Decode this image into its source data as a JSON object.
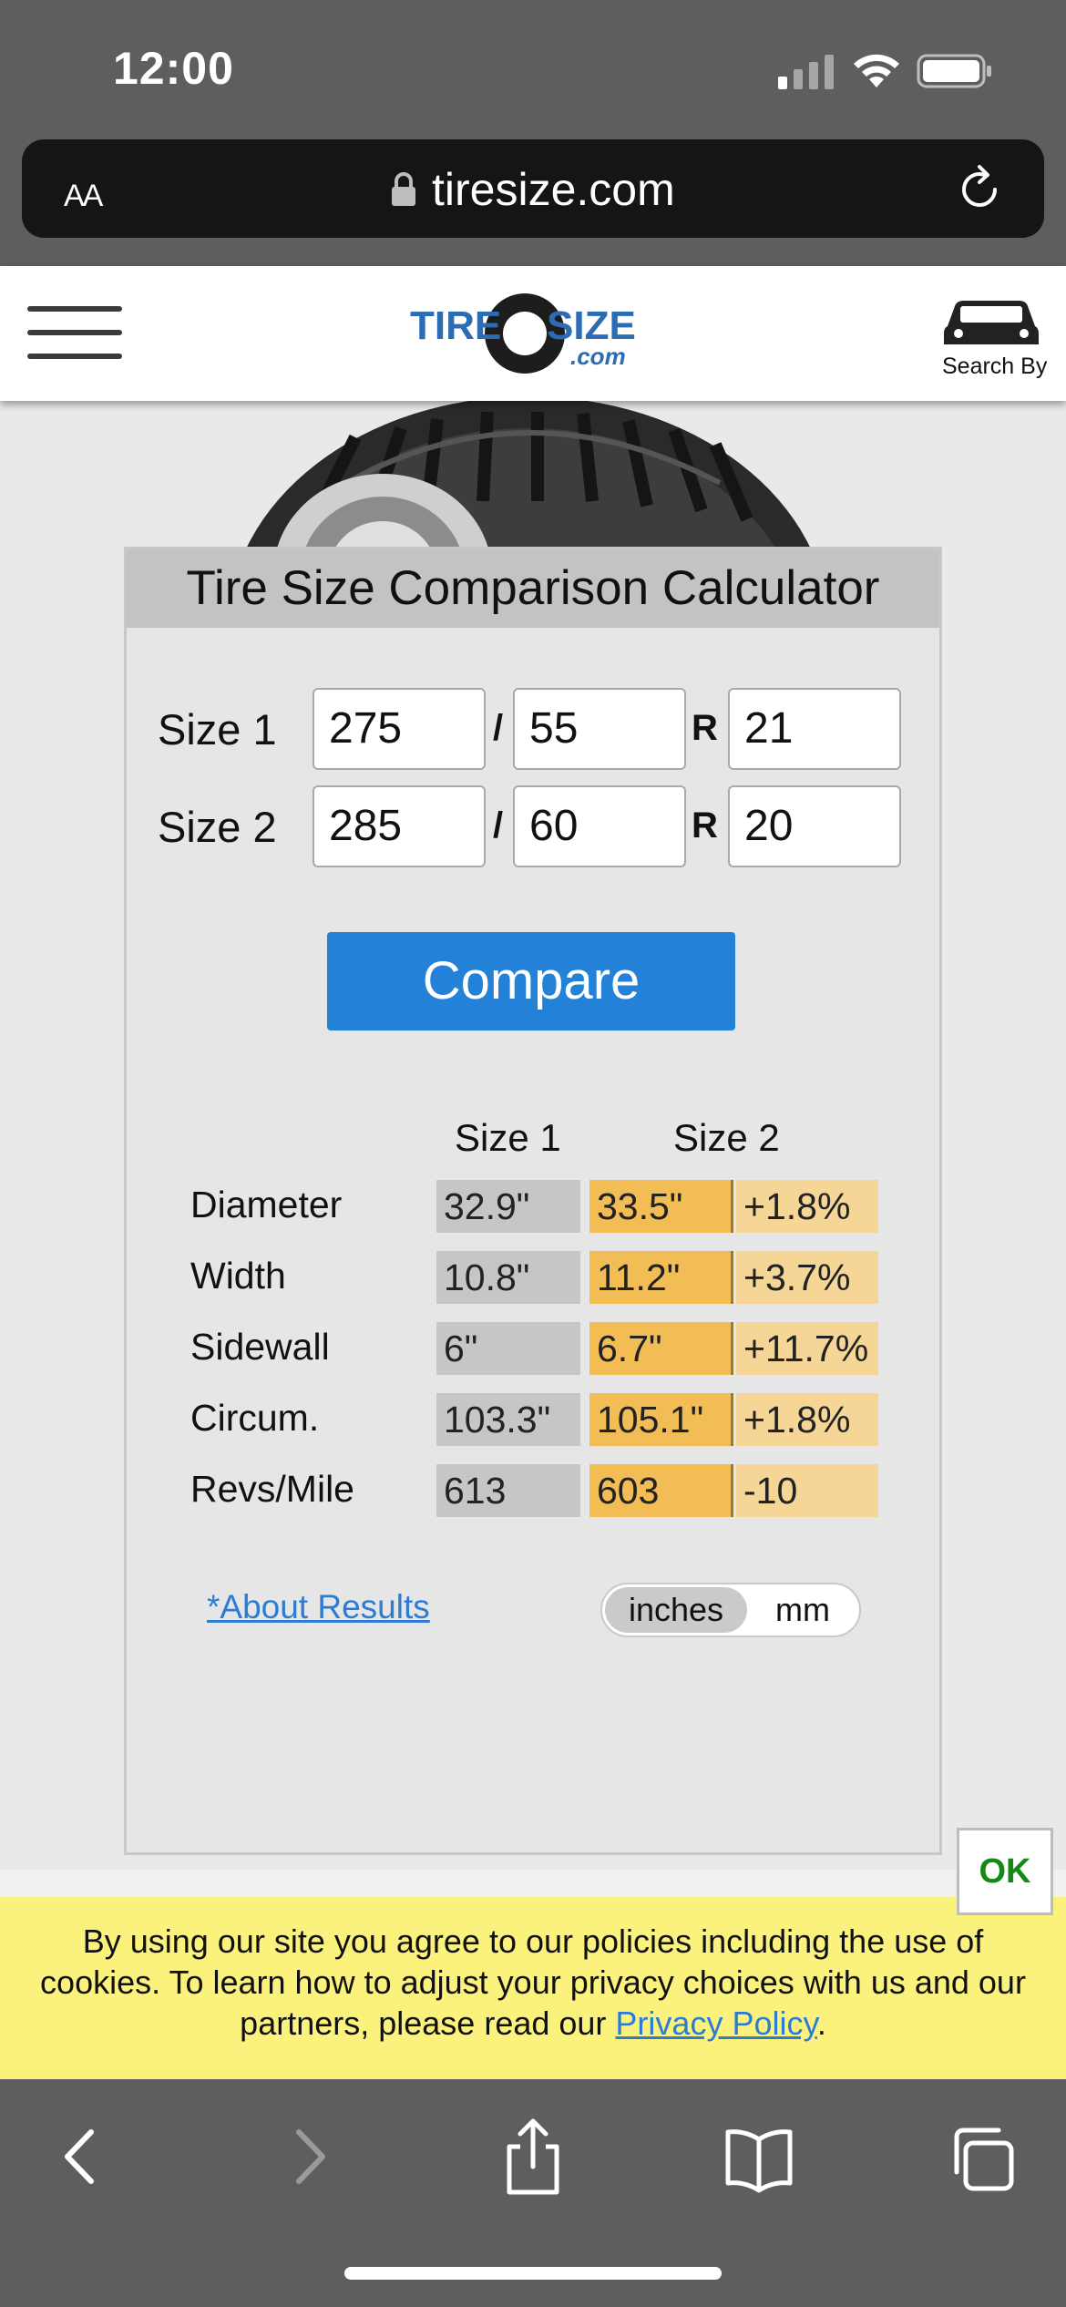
{
  "status_bar": {
    "time": "12:00"
  },
  "browser": {
    "text_size_label": "AA",
    "domain": "tiresize.com"
  },
  "site_header": {
    "logo_text": "TIRESIZE.com",
    "search_by_label": "Search By"
  },
  "calculator": {
    "title": "Tire Size Comparison Calculator",
    "size1": {
      "label": "Size 1",
      "width": "275",
      "aspect": "55",
      "rim": "21"
    },
    "size2": {
      "label": "Size 2",
      "width": "285",
      "aspect": "60",
      "rim": "20"
    },
    "separator_slash": "/",
    "separator_r": "R",
    "compare_label": "Compare",
    "results": {
      "col_size1": "Size 1",
      "col_size2": "Size 2",
      "rows": [
        {
          "label": "Diameter",
          "size1": "32.9\"",
          "size2": "33.5\"",
          "diff": "+1.8%"
        },
        {
          "label": "Width",
          "size1": "10.8\"",
          "size2": "11.2\"",
          "diff": "+3.7%"
        },
        {
          "label": "Sidewall",
          "size1": "6\"",
          "size2": "6.7\"",
          "diff": "+11.7%"
        },
        {
          "label": "Circum.",
          "size1": "103.3\"",
          "size2": "105.1\"",
          "diff": "+1.8%"
        },
        {
          "label": "Revs/Mile",
          "size1": "613",
          "size2": "603",
          "diff": "-10"
        }
      ]
    },
    "about_link": "*About Results",
    "units": {
      "inches": "inches",
      "mm": "mm",
      "selected": "inches"
    }
  },
  "cookie_banner": {
    "text": "By using our site you agree to our policies including the use of cookies. To learn how to adjust your privacy choices with us and our partners, please read our ",
    "link": "Privacy Policy",
    "end": ".",
    "ok_label": "OK"
  }
}
